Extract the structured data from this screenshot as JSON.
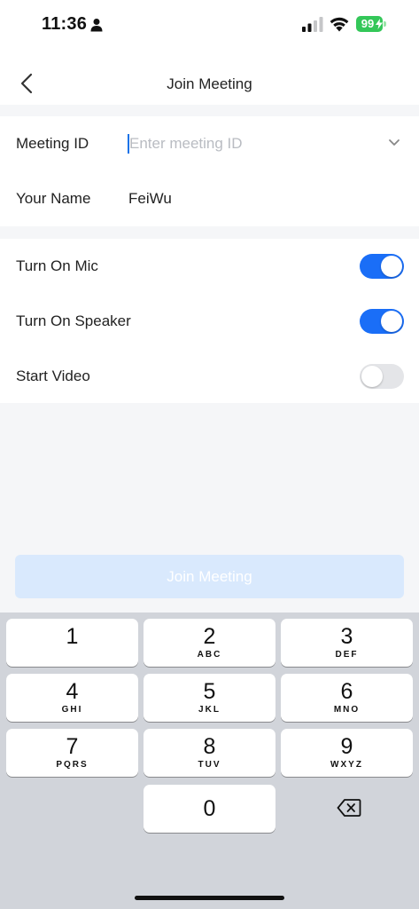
{
  "status_bar": {
    "time": "11:36",
    "battery_level": "99",
    "icons": [
      "person-icon",
      "signal-icon",
      "wifi-icon",
      "battery-icon",
      "bolt-icon"
    ]
  },
  "nav": {
    "title": "Join Meeting",
    "back_icon": "chevron-left-icon"
  },
  "form": {
    "meeting_id": {
      "label": "Meeting ID",
      "value": "",
      "placeholder": "Enter meeting ID",
      "dropdown_icon": "chevron-down-icon"
    },
    "your_name": {
      "label": "Your Name",
      "value": "FeiWu"
    }
  },
  "settings": [
    {
      "label": "Turn On Mic",
      "enabled": true
    },
    {
      "label": "Turn On Speaker",
      "enabled": true
    },
    {
      "label": "Start Video",
      "enabled": false
    }
  ],
  "join_button": {
    "label": "Join Meeting",
    "enabled": false
  },
  "keypad": {
    "keys": [
      {
        "num": "1",
        "letters": ""
      },
      {
        "num": "2",
        "letters": "ABC"
      },
      {
        "num": "3",
        "letters": "DEF"
      },
      {
        "num": "4",
        "letters": "GHI"
      },
      {
        "num": "5",
        "letters": "JKL"
      },
      {
        "num": "6",
        "letters": "MNO"
      },
      {
        "num": "7",
        "letters": "PQRS"
      },
      {
        "num": "8",
        "letters": "TUV"
      },
      {
        "num": "9",
        "letters": "WXYZ"
      },
      {
        "num": "0",
        "letters": ""
      }
    ],
    "delete_icon": "backspace-icon"
  },
  "colors": {
    "accent": "#1a6ef7",
    "join_button_disabled": "#d9e9fd",
    "keyboard_bg": "#d1d4da",
    "battery": "#34c759"
  }
}
